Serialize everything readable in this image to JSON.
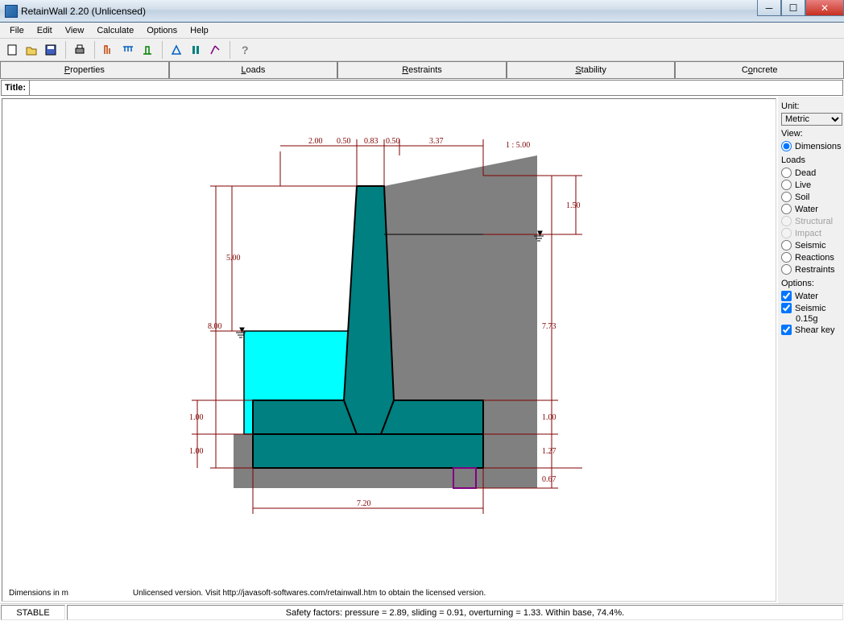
{
  "window": {
    "title": "RetainWall 2.20 (Unlicensed)"
  },
  "menu": {
    "file": "File",
    "edit": "Edit",
    "view": "View",
    "calculate": "Calculate",
    "options": "Options",
    "help": "Help"
  },
  "tabs": {
    "properties": "Properties",
    "loads": "Loads",
    "restraints": "Restraints",
    "stability": "Stability",
    "concrete": "Concrete"
  },
  "title_field": {
    "label": "Title:",
    "value": ""
  },
  "side": {
    "unit_label": "Unit:",
    "unit_value": "Metric",
    "view_label": "View:",
    "view_dimensions": "Dimensions",
    "loads_label": "Loads",
    "load_dead": "Dead",
    "load_live": "Live",
    "load_soil": "Soil",
    "load_water": "Water",
    "load_structural": "Structural",
    "load_impact": "Impact",
    "load_seismic": "Seismic",
    "load_reactions": "Reactions",
    "load_restraints": "Restraints",
    "options_label": "Options:",
    "opt_water": "Water",
    "opt_seismic": "Seismic",
    "opt_seismic_val": "0.15g",
    "opt_shearkey": "Shear key"
  },
  "status": {
    "stable": "STABLE",
    "factors": "Safety factors: pressure = 2.89, sliding = 0.91, overturning = 1.33. Within base, 74.4%."
  },
  "canvas": {
    "dim_unit_note": "Dimensions in m",
    "license_note": "Unlicensed version. Visit http://javasoft-softwares.com/retainwall.htm to obtain the licensed version.",
    "dims": {
      "toe_width": "2.00",
      "stem_top_left": "0.50",
      "stem_top_right": "0.50",
      "stem_bot": "0.83",
      "heel_width": "3.37",
      "surcharge_slope": "1 : 5.00",
      "wall_height": "5.00",
      "total_height": "8.00",
      "soil_above_water": "1.50",
      "soil_height": "7.73",
      "toe_depth": "1.00",
      "base_to_key": "1.00",
      "heel_step": "1.00",
      "base_plus": "1.27",
      "key_depth": "0.67",
      "base_width": "7.20"
    }
  },
  "toolbar_icons": [
    "new",
    "open",
    "save",
    "print",
    "calc1",
    "calc2",
    "calc3",
    "view1",
    "view2",
    "view3",
    "help"
  ]
}
